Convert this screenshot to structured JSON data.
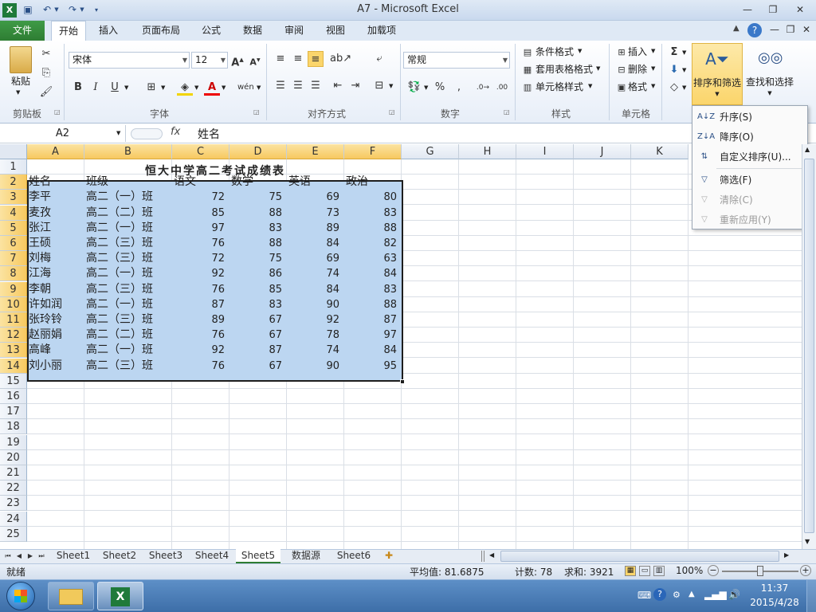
{
  "window": {
    "title": "A7 - Microsoft Excel"
  },
  "quick_access": {
    "save_icon": "save-icon",
    "undo_icon": "undo-icon",
    "redo_icon": "redo-icon"
  },
  "ribbon_tabs": [
    "文件",
    "开始",
    "插入",
    "页面布局",
    "公式",
    "数据",
    "审阅",
    "视图",
    "加载项"
  ],
  "groups": {
    "clipboard": {
      "label": "剪贴板",
      "paste": "粘贴"
    },
    "font": {
      "label": "字体",
      "name": "宋体",
      "size": "12"
    },
    "alignment": {
      "label": "对齐方式"
    },
    "number": {
      "label": "数字",
      "format": "常规"
    },
    "styles": {
      "label": "样式",
      "conditional": "条件格式",
      "table": "套用表格格式",
      "cell": "单元格样式"
    },
    "cells": {
      "label": "单元格",
      "insert": "插入",
      "delete": "删除",
      "format": "格式"
    },
    "editing": {
      "sort_filter": "排序和筛选",
      "find_select": "查找和选择"
    }
  },
  "sort_menu": {
    "ascending": "升序(S)",
    "descending": "降序(O)",
    "custom": "自定义排序(U)...",
    "filter": "筛选(F)",
    "clear": "清除(C)",
    "reapply": "重新应用(Y)"
  },
  "formula_bar": {
    "name_box": "A2",
    "fx": "fx",
    "value": "姓名"
  },
  "columns": [
    "A",
    "B",
    "C",
    "D",
    "E",
    "F",
    "G",
    "H",
    "I",
    "J",
    "K"
  ],
  "rows": [
    "1",
    "2",
    "3",
    "4",
    "5",
    "6",
    "7",
    "8",
    "9",
    "10",
    "11",
    "12",
    "13",
    "14",
    "15",
    "16",
    "17",
    "18",
    "19",
    "20",
    "21",
    "22",
    "23",
    "24",
    "25"
  ],
  "sheet": {
    "title": "恒大中学高二考试成绩表",
    "headers": [
      "姓名",
      "班级",
      "语文",
      "数学",
      "英语",
      "政治"
    ],
    "data": [
      [
        "李平",
        "高二（一）班",
        "72",
        "75",
        "69",
        "80"
      ],
      [
        "麦孜",
        "高二（二）班",
        "85",
        "88",
        "73",
        "83"
      ],
      [
        "张江",
        "高二（一）班",
        "97",
        "83",
        "89",
        "88"
      ],
      [
        "王硕",
        "高二（三）班",
        "76",
        "88",
        "84",
        "82"
      ],
      [
        "刘梅",
        "高二（三）班",
        "72",
        "75",
        "69",
        "63"
      ],
      [
        "江海",
        "高二（一）班",
        "92",
        "86",
        "74",
        "84"
      ],
      [
        "李朝",
        "高二（三）班",
        "76",
        "85",
        "84",
        "83"
      ],
      [
        "许如润",
        "高二（一）班",
        "87",
        "83",
        "90",
        "88"
      ],
      [
        "张玲铃",
        "高二（三）班",
        "89",
        "67",
        "92",
        "87"
      ],
      [
        "赵丽娟",
        "高二（二）班",
        "76",
        "67",
        "78",
        "97"
      ],
      [
        "高峰",
        "高二（一）班",
        "92",
        "87",
        "74",
        "84"
      ],
      [
        "刘小丽",
        "高二（三）班",
        "76",
        "67",
        "90",
        "95"
      ]
    ]
  },
  "sheet_tabs": [
    "Sheet1",
    "Sheet2",
    "Sheet3",
    "Sheet4",
    "Sheet5",
    "数据源",
    "Sheet6"
  ],
  "active_sheet": "Sheet5",
  "status": {
    "ready": "就绪",
    "average": "平均值: 81.6875",
    "count": "计数: 78",
    "sum": "求和: 3921",
    "zoom": "100%"
  },
  "taskbar": {
    "time": "11:37",
    "date": "2015/4/28"
  },
  "colors": {
    "accent": "#2e7d33",
    "selection": "#bcd6f1",
    "ribbon": "#dfe9f5"
  }
}
